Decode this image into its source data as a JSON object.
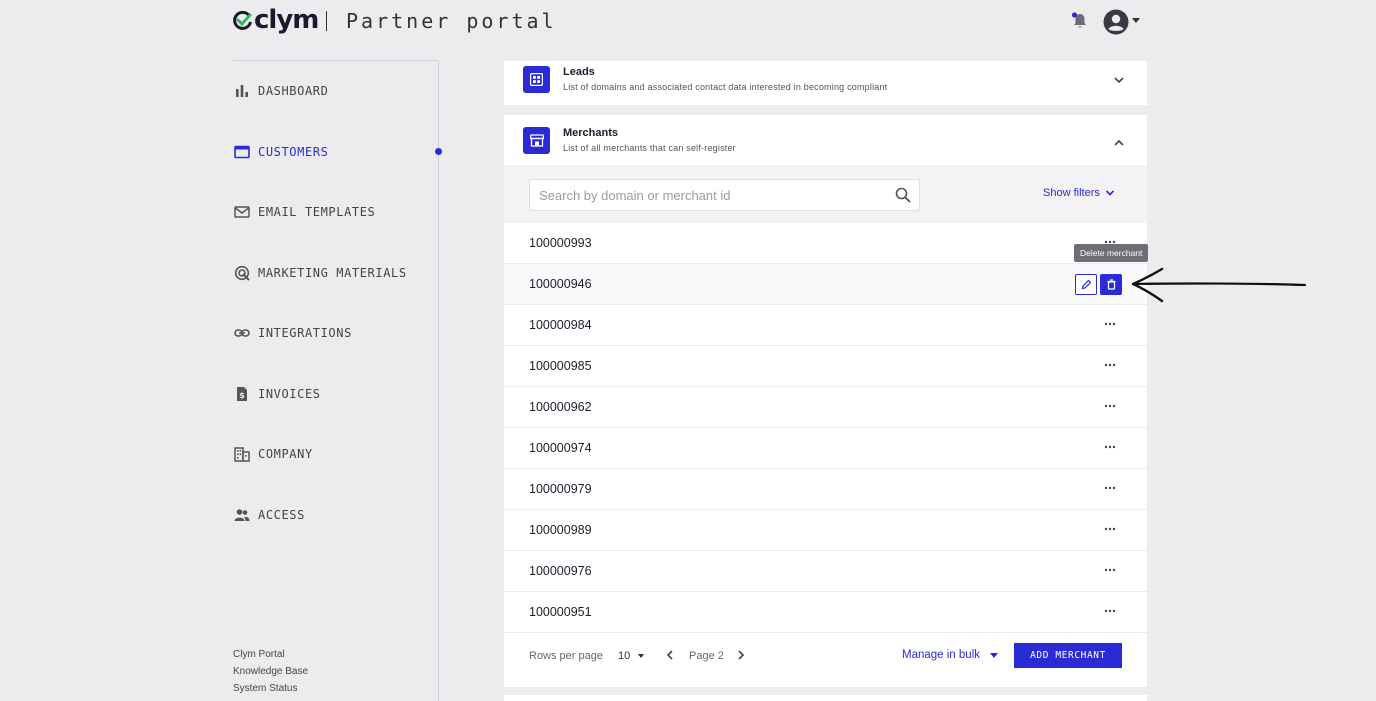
{
  "header": {
    "logo_text": "clym",
    "portal_title": "Partner portal"
  },
  "sidebar": {
    "items": [
      {
        "label": "DASHBOARD",
        "icon": "bar-chart-icon"
      },
      {
        "label": "CUSTOMERS",
        "icon": "folder-icon",
        "active": true
      },
      {
        "label": "EMAIL TEMPLATES",
        "icon": "mail-icon"
      },
      {
        "label": "MARKETING MATERIALS",
        "icon": "target-icon"
      },
      {
        "label": "INTEGRATIONS",
        "icon": "link-icon"
      },
      {
        "label": "INVOICES",
        "icon": "invoice-icon"
      },
      {
        "label": "COMPANY",
        "icon": "building-icon"
      },
      {
        "label": "ACCESS",
        "icon": "people-icon"
      }
    ],
    "footer": [
      "Clym Portal",
      "Knowledge Base",
      "System Status"
    ]
  },
  "leads": {
    "title": "Leads",
    "subtitle": "List of domains and associated contact data interested in becoming compliant"
  },
  "merchants": {
    "title": "Merchants",
    "subtitle": "List of all merchants that can self-register",
    "search_placeholder": "Search by domain or merchant id",
    "show_filters": "Show filters",
    "tooltip": "Delete merchant",
    "rows": [
      "100000993",
      "100000946",
      "100000984",
      "100000985",
      "100000962",
      "100000974",
      "100000979",
      "100000989",
      "100000976",
      "100000951"
    ],
    "pagination": {
      "rows_per_page_label": "Rows per page",
      "rows_per_page_value": "10",
      "page_label": "Page 2",
      "manage_bulk": "Manage in bulk",
      "add_merchant": "ADD MERCHANT"
    }
  },
  "colors": {
    "accent": "#2b2bd6",
    "background": "#ececee",
    "card": "#ffffff"
  }
}
